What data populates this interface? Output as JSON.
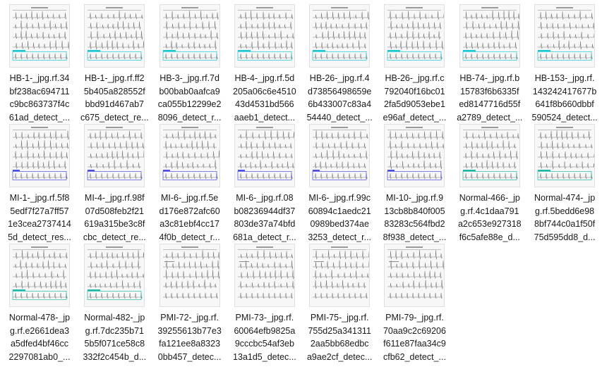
{
  "files": [
    {
      "line1": "HB-1-_jpg.rf.34",
      "line2": "bf238ac694711",
      "line3": "c9bc863737f4c",
      "line4": "61ad_detect_...",
      "box": "cyan"
    },
    {
      "line1": "HB-1-_jpg.rf.ff2",
      "line2": "5b405a828552f",
      "line3": "bbd91d467ab7",
      "line4": "c675_detect_re...",
      "box": "cyan"
    },
    {
      "line1": "HB-3-_jpg.rf.7d",
      "line2": "b00bab0aafca9",
      "line3": "ca055b12299e2",
      "line4": "8096_detect_r...",
      "box": "cyan"
    },
    {
      "line1": "HB-4-_jpg.rf.5d",
      "line2": "205a06c6e4510",
      "line3": "43d4531bd566",
      "line4": "aaeb1_detect...",
      "box": "cyan"
    },
    {
      "line1": "HB-26-_jpg.rf.4",
      "line2": "d73856498659e",
      "line3": "6b433007c83a4",
      "line4": "54440_detect_...",
      "box": "cyan"
    },
    {
      "line1": "HB-26-_jpg.rf.c",
      "line2": "792040f16bc01",
      "line3": "2fa5d9053ebe1",
      "line4": "e96af_detect_...",
      "box": "cyan"
    },
    {
      "line1": "HB-74-_jpg.rf.b",
      "line2": "15783f6b6335f",
      "line3": "ed8147716d55f",
      "line4": "a2789_detect_...",
      "box": "cyan"
    },
    {
      "line1": "HB-153-_jpg.rf.",
      "line2": "143242417677b",
      "line3": "641f8b660dbbf",
      "line4": "590524_detect...",
      "box": "cyan"
    },
    {
      "line1": "MI-1-_jpg.rf.5f8",
      "line2": "5edf7f27a7ff57",
      "line3": "1e3cea2737414",
      "line4": "5d_detect_res...",
      "box": "blue"
    },
    {
      "line1": "MI-4-_jpg.rf.98f",
      "line2": "07d508feb2f21",
      "line3": "619a315be3c8f",
      "line4": "cbc_detect_re...",
      "box": "blue"
    },
    {
      "line1": "MI-6-_jpg.rf.5e",
      "line2": "d176e872afc60",
      "line3": "a3c81ebf4cc17",
      "line4": "4f0b_detect_r...",
      "box": "blue"
    },
    {
      "line1": "MI-6-_jpg.rf.08",
      "line2": "b08236944df37",
      "line3": "803de37a74bfd",
      "line4": "681a_detect_r...",
      "box": "blue"
    },
    {
      "line1": "MI-6-_jpg.rf.99c",
      "line2": "60894c1aedc21",
      "line3": "0989bed374ae",
      "line4": "3253_detect_r...",
      "box": "blue"
    },
    {
      "line1": "MI-10-_jpg.rf.9",
      "line2": "13cb8b840f005",
      "line3": "83283c564fbd2",
      "line4": "8f938_detect_...",
      "box": "blue"
    },
    {
      "line1": "Normal-466-_jp",
      "line2": "g.rf.4c1daa791",
      "line3": "a2c653e927318",
      "line4": "f6c5afe88e_d...",
      "box": "teal"
    },
    {
      "line1": "Normal-474-_jp",
      "line2": "g.rf.5bedd6e98",
      "line3": "8bf744c0a1f50f",
      "line4": "75d595dd8_d...",
      "box": "teal"
    },
    {
      "line1": "Normal-478-_jp",
      "line2": "g.rf.e2661dea3",
      "line3": "a5dfed4bf46cc",
      "line4": "2297081ab0_...",
      "box": "teal"
    },
    {
      "line1": "Normal-482-_jp",
      "line2": "g.rf.7dc235b71",
      "line3": "5b5f071ce58c8",
      "line4": "332f2c454b_d...",
      "box": "teal"
    },
    {
      "line1": "PMI-72-_jpg.rf.",
      "line2": "39255613b77e3",
      "line3": "fa121ee8a8323",
      "line4": "0bb457_detec...",
      "box": "none"
    },
    {
      "line1": "PMI-73-_jpg.rf.",
      "line2": "60064efb9825a",
      "line3": "9cccbc54af3eb",
      "line4": "13a1d5_detec...",
      "box": "none"
    },
    {
      "line1": "PMI-75-_jpg.rf.",
      "line2": "755d25a341311",
      "line3": "2aa5bb68edbc",
      "line4": "a9ae2cf_detec...",
      "box": "none"
    },
    {
      "line1": "PMI-79-_jpg.rf.",
      "line2": "70aa9c2c69206",
      "line3": "f611e87faa34c9",
      "line4": "cfb62_detect_...",
      "box": "none"
    }
  ],
  "colors": {
    "cyan": "#19c8d4",
    "blue": "#4a4ee0",
    "teal": "#1fb8a8",
    "trace": "#7a7a7a",
    "paper": "#f7f7f7"
  }
}
